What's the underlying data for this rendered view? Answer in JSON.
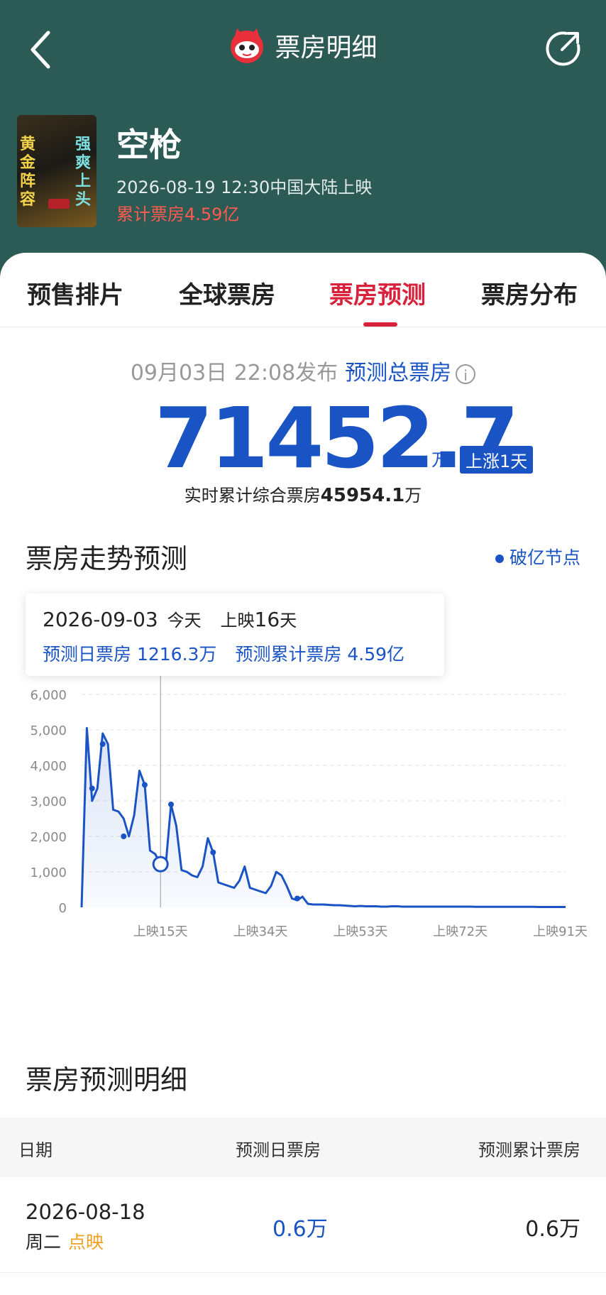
{
  "nav": {
    "title": "票房明细"
  },
  "movie": {
    "poster_text_left": "黄金阵容",
    "poster_text_right": "强爽上头",
    "title": "空枪",
    "release": "2026-08-19 12:30中国大陆上映",
    "box_office": "累计票房4.59亿"
  },
  "tabs": [
    {
      "label": "预售排片"
    },
    {
      "label": "全球票房"
    },
    {
      "label": "票房预测",
      "active": true
    },
    {
      "label": "票房分布"
    }
  ],
  "forecast": {
    "published": "09月03日 22:08发布",
    "label": "预测总票房",
    "info_symbol": "i",
    "total": "71452.7",
    "unit": "万",
    "badge": "上涨1天",
    "realtime_prefix": "实时累计综合票房",
    "realtime_value": "45954.1",
    "realtime_unit": "万"
  },
  "trend": {
    "title": "票房走势预测",
    "legend": "破亿节点",
    "tooltip": {
      "date": "2026-09-03",
      "today": "今天",
      "day_prefix": "上映",
      "day_num": "16",
      "day_suffix": "天",
      "daily": "预测日票房 1216.3万",
      "cumulative": "预测累计票房 4.59亿"
    }
  },
  "chart_data": {
    "type": "area",
    "y_ticks": [
      "6,000",
      "5,000",
      "4,000",
      "3,000",
      "2,000",
      "1,000",
      "0"
    ],
    "ylim": [
      0,
      6000
    ],
    "x_ticks": [
      {
        "day": 15,
        "label": "上映15天"
      },
      {
        "day": 34,
        "label": "上映34天"
      },
      {
        "day": 53,
        "label": "上映53天"
      },
      {
        "day": 72,
        "label": "上映72天"
      },
      {
        "day": 91,
        "label": "上映91天"
      }
    ],
    "xlim": [
      0,
      92
    ],
    "series": [
      {
        "x": [
          0,
          1,
          2,
          3,
          4,
          5,
          6,
          7,
          8,
          9,
          10,
          11,
          12,
          13,
          14,
          15,
          16,
          17,
          18,
          19,
          20,
          21,
          22,
          23,
          24,
          25,
          26,
          27,
          28,
          29,
          30,
          31,
          32,
          33,
          34,
          35,
          36,
          37,
          38,
          39,
          40,
          41,
          42,
          43,
          44,
          45,
          46,
          47,
          48,
          49,
          50,
          51,
          52,
          53,
          54,
          55,
          56,
          57,
          58,
          59,
          60,
          61,
          62,
          63,
          64,
          65,
          66,
          67,
          68,
          69,
          70,
          71,
          72,
          73,
          74,
          75,
          76,
          77,
          78,
          79,
          80,
          81,
          82,
          83,
          84,
          85,
          86,
          87,
          88,
          89,
          90,
          91,
          92
        ],
        "y": [
          0,
          5050,
          3000,
          3350,
          4900,
          4600,
          2750,
          2700,
          2500,
          2000,
          2600,
          3850,
          3450,
          1600,
          1500,
          1216,
          1200,
          2900,
          2300,
          1050,
          1000,
          900,
          850,
          1150,
          1950,
          1550,
          700,
          650,
          600,
          550,
          750,
          1150,
          550,
          500,
          450,
          400,
          600,
          1000,
          900,
          600,
          250,
          200,
          300,
          100,
          80,
          80,
          80,
          70,
          60,
          60,
          50,
          40,
          30,
          40,
          30,
          30,
          30,
          20,
          20,
          30,
          30,
          20,
          20,
          20,
          20,
          20,
          20,
          20,
          20,
          20,
          20,
          20,
          20,
          20,
          20,
          15,
          15,
          15,
          15,
          15,
          15,
          15,
          15,
          15,
          15,
          15,
          15,
          10,
          10,
          10,
          10,
          10,
          10
        ]
      }
    ],
    "markers": [
      {
        "x": 2,
        "y": 3350
      },
      {
        "x": 4,
        "y": 4600
      },
      {
        "x": 8,
        "y": 2000
      },
      {
        "x": 12,
        "y": 3450
      },
      {
        "x": 17,
        "y": 2900
      },
      {
        "x": 25,
        "y": 1550
      },
      {
        "x": 41,
        "y": 250
      }
    ],
    "highlight": {
      "x": 15,
      "y": 1216.3
    }
  },
  "detail": {
    "title": "票房预测明细",
    "columns": [
      "日期",
      "预测日票房",
      "预测累计票房"
    ],
    "rows": [
      {
        "date": "2026-08-18",
        "weekday": "周二",
        "tag": "点映",
        "daily": "0.6万",
        "cumulative": "0.6万"
      }
    ]
  },
  "colors": {
    "header_bg": "#2c5a55",
    "accent_blue": "#1a54c4",
    "accent_red": "#d8223b",
    "tag_orange": "#f0a020"
  }
}
